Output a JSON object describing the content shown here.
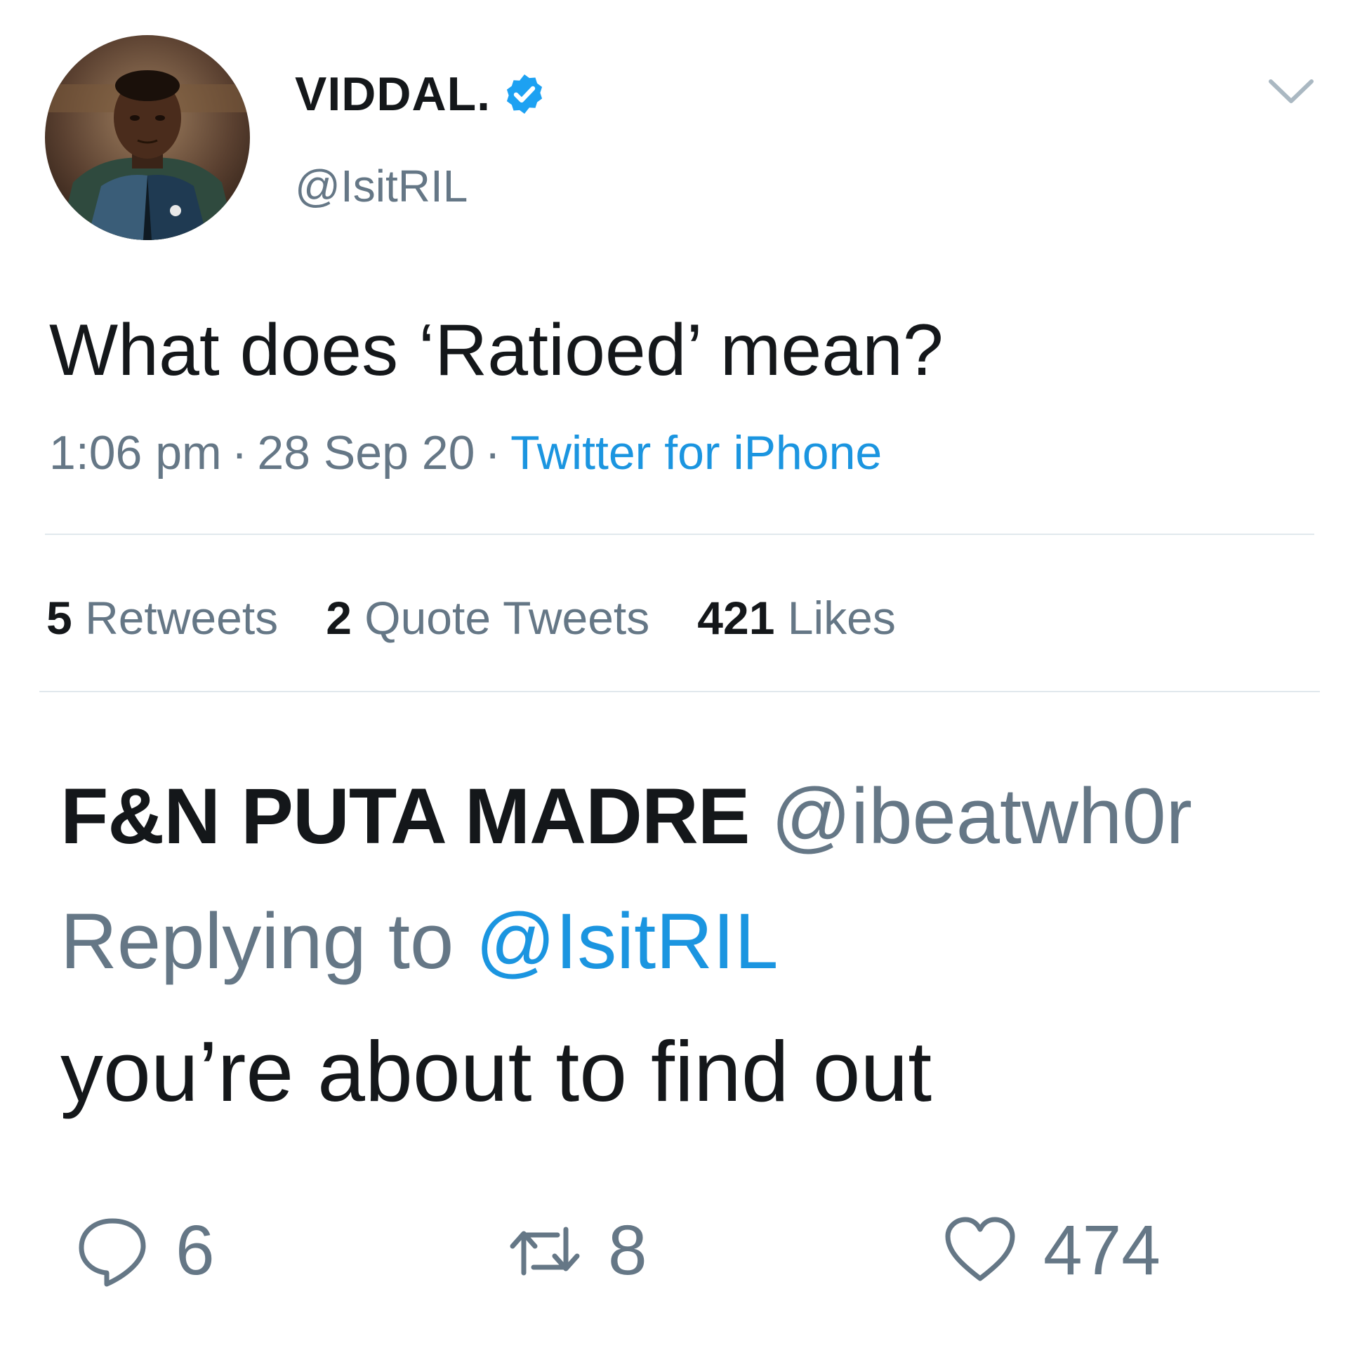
{
  "tweet": {
    "author": {
      "display_name": "VIDDAL.",
      "handle": "@IsitRIL",
      "verified": true,
      "avatar_icon": "profile-photo"
    },
    "text": "What does ‘Ratioed’ mean?",
    "time": "1:06 pm",
    "date": "28 Sep 20",
    "separator": "·",
    "source": "Twitter for iPhone",
    "menu_icon": "chevron-down-icon",
    "stats": {
      "retweets": {
        "count": "5",
        "label": "Retweets"
      },
      "quote_tweets": {
        "count": "2",
        "label": "Quote Tweets"
      },
      "likes": {
        "count": "421",
        "label": "Likes"
      }
    }
  },
  "reply": {
    "author": {
      "display_name": "F&N PUTA MADRE",
      "handle": "@ibeatwh0r"
    },
    "replying_prefix": "Replying to",
    "replying_to": "@IsitRIL",
    "text": "you’re about to find out",
    "actions": {
      "reply": {
        "icon": "reply-icon",
        "count": "6"
      },
      "retweet": {
        "icon": "retweet-icon",
        "count": "8"
      },
      "like": {
        "icon": "heart-icon",
        "count": "474"
      }
    }
  },
  "colors": {
    "text_primary": "#14171a",
    "text_secondary": "#657786",
    "link": "#1b95e0",
    "verified_badge": "#1da1f2",
    "divider": "#e1e8ed"
  }
}
